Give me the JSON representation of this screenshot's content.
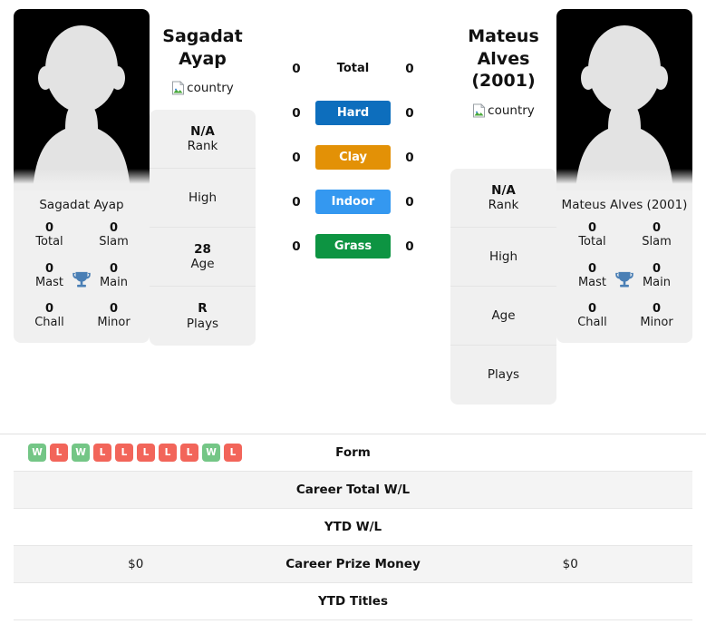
{
  "players": {
    "left": {
      "name": "Sagadat Ayap",
      "card_name": "Sagadat Ayap",
      "country_alt": "country",
      "avatar_alt": "player-photo",
      "info": [
        {
          "value": "N/A",
          "label": "Rank"
        },
        {
          "value": "",
          "label": "High"
        },
        {
          "value": "28",
          "label": "Age"
        },
        {
          "value": "R",
          "label": "Plays"
        }
      ],
      "titles": [
        {
          "value": "0",
          "label": "Total"
        },
        {
          "value": "0",
          "label": "Slam"
        },
        {
          "value": "0",
          "label": "Mast"
        },
        {
          "value": "0",
          "label": "Main"
        },
        {
          "value": "0",
          "label": "Chall"
        },
        {
          "value": "0",
          "label": "Minor"
        }
      ],
      "surface_counts": [
        "0",
        "0",
        "0",
        "0",
        "0"
      ],
      "form": [
        "W",
        "L",
        "W",
        "L",
        "L",
        "L",
        "L",
        "L",
        "W",
        "L"
      ],
      "career_total_wl": "",
      "ytd_wl": "",
      "career_prize_money": "$0",
      "ytd_titles": ""
    },
    "right": {
      "name": "Mateus Alves (2001)",
      "card_name": "Mateus Alves (2001)",
      "country_alt": "country",
      "avatar_alt": "player-photo",
      "info": [
        {
          "value": "N/A",
          "label": "Rank"
        },
        {
          "value": "",
          "label": "High"
        },
        {
          "value": "",
          "label": "Age"
        },
        {
          "value": "",
          "label": "Plays"
        }
      ],
      "titles": [
        {
          "value": "0",
          "label": "Total"
        },
        {
          "value": "0",
          "label": "Slam"
        },
        {
          "value": "0",
          "label": "Mast"
        },
        {
          "value": "0",
          "label": "Main"
        },
        {
          "value": "0",
          "label": "Chall"
        },
        {
          "value": "0",
          "label": "Minor"
        }
      ],
      "surface_counts": [
        "0",
        "0",
        "0",
        "0",
        "0"
      ],
      "form": [],
      "career_total_wl": "",
      "ytd_wl": "",
      "career_prize_money": "$0",
      "ytd_titles": ""
    }
  },
  "surfaces": [
    {
      "label": "Total",
      "color": "transparent",
      "text_color": "#111111",
      "plain": true
    },
    {
      "label": "Hard",
      "color": "#0d6ebd",
      "text_color": "#ffffff",
      "plain": false
    },
    {
      "label": "Clay",
      "color": "#e39106",
      "text_color": "#ffffff",
      "plain": false
    },
    {
      "label": "Indoor",
      "color": "#3498f0",
      "text_color": "#ffffff",
      "plain": false
    },
    {
      "label": "Grass",
      "color": "#0d9442",
      "text_color": "#ffffff",
      "plain": false
    }
  ],
  "table_rows": [
    {
      "label": "Form",
      "type": "form"
    },
    {
      "label": "Career Total W/L",
      "type": "text"
    },
    {
      "label": "YTD W/L",
      "type": "text"
    },
    {
      "label": "Career Prize Money",
      "type": "text"
    },
    {
      "label": "YTD Titles",
      "type": "text"
    }
  ],
  "colors": {
    "win_badge": "#74c686",
    "loss_badge": "#f2655a",
    "trophy": "#4a7fb5",
    "card_bg": "#f0f0f0",
    "stripe_bg": "#f4f4f4"
  }
}
